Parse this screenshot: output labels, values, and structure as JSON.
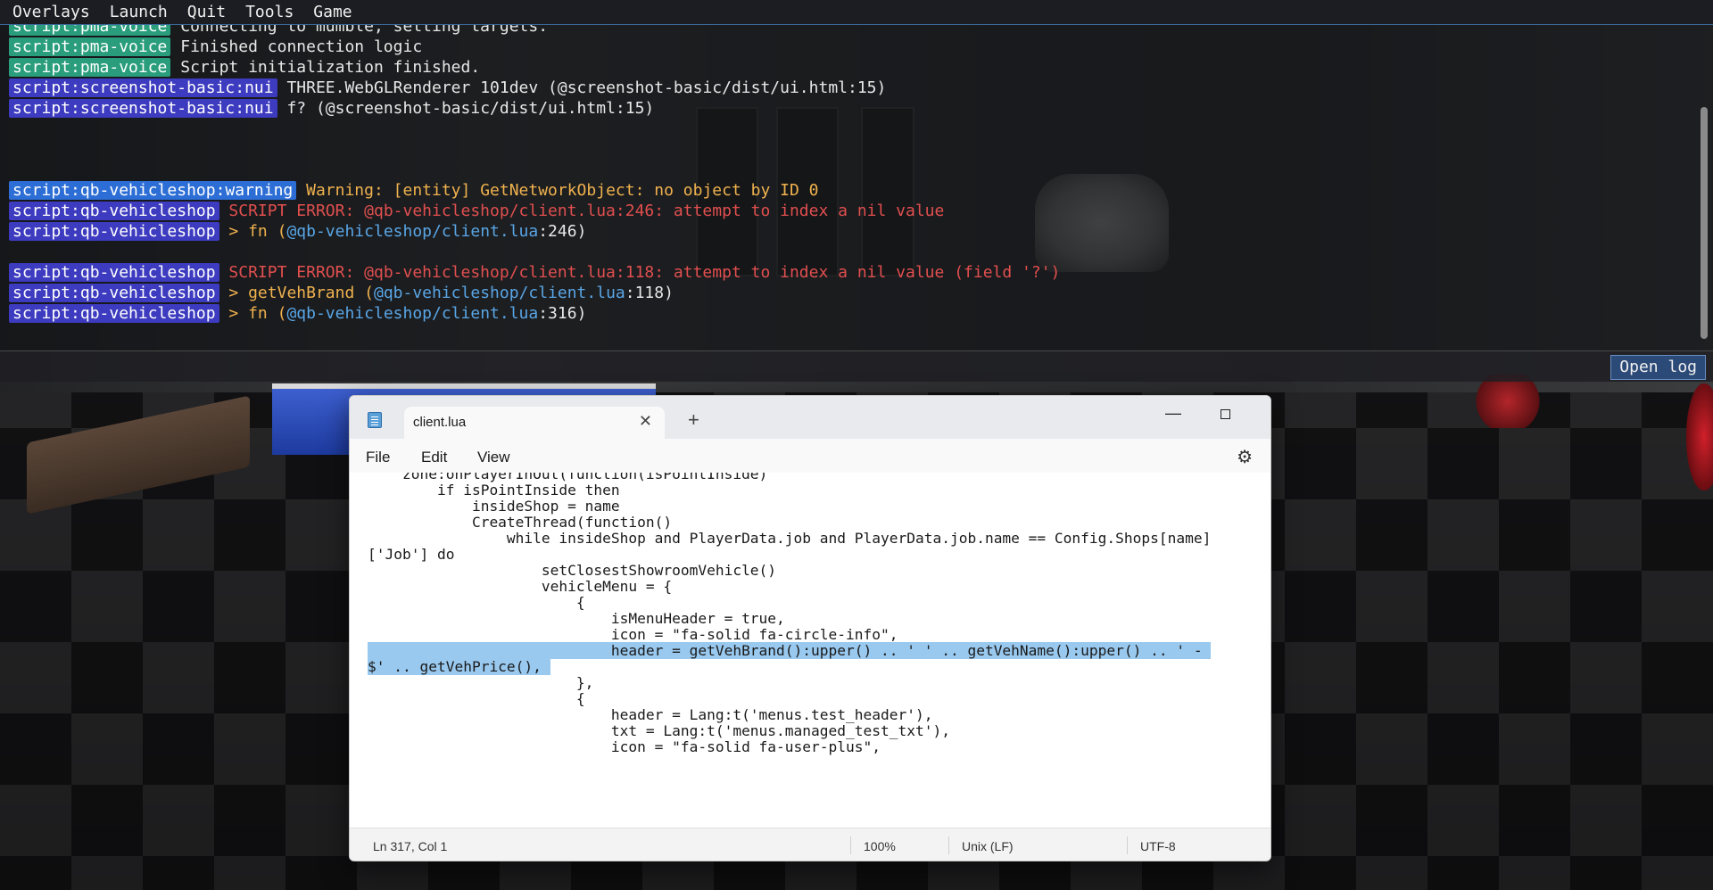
{
  "menubar": {
    "items": [
      "Overlays",
      "Launch",
      "Quit",
      "Tools",
      "Game"
    ]
  },
  "console": {
    "lines": [
      {
        "tag": "script:pma-voice",
        "tag_color": "green",
        "parts": [
          {
            "text": "Connecting to mumble, setting targets.",
            "cls": "c-white"
          }
        ]
      },
      {
        "tag": "script:pma-voice",
        "tag_color": "green",
        "parts": [
          {
            "text": "Finished connection logic",
            "cls": "c-white"
          }
        ]
      },
      {
        "tag": "script:pma-voice",
        "tag_color": "green",
        "parts": [
          {
            "text": "Script initialization finished.",
            "cls": "c-white"
          }
        ]
      },
      {
        "tag": "script:screenshot-basic:nui",
        "tag_color": "purple",
        "parts": [
          {
            "text": "THREE.WebGLRenderer 101dev (@screenshot-basic/dist/ui.html:15)",
            "cls": "c-white"
          }
        ]
      },
      {
        "tag": "script:screenshot-basic:nui",
        "tag_color": "purple",
        "parts": [
          {
            "text": "f? (@screenshot-basic/dist/ui.html:15)",
            "cls": "c-white"
          }
        ]
      },
      {
        "tag": "",
        "tag_color": "",
        "parts": []
      },
      {
        "tag": "",
        "tag_color": "",
        "parts": []
      },
      {
        "tag": "",
        "tag_color": "",
        "parts": []
      },
      {
        "tag": "script:qb-vehicleshop:warning",
        "tag_color": "blue",
        "parts": [
          {
            "text": "Warning: [entity] GetNetworkObject: no object by ID 0",
            "cls": "c-warn"
          }
        ]
      },
      {
        "tag": "script:qb-vehicleshop",
        "tag_color": "purple",
        "parts": [
          {
            "text": "SCRIPT ERROR: @qb-vehicleshop/client.lua:246: attempt to index a nil value",
            "cls": "c-err"
          }
        ]
      },
      {
        "tag": "script:qb-vehicleshop",
        "tag_color": "purple",
        "parts": [
          {
            "text": "> fn (",
            "cls": "c-orange"
          },
          {
            "text": "@qb-vehicleshop/client.lua",
            "cls": "c-link"
          },
          {
            "text": ":246)",
            "cls": "c-white"
          }
        ]
      },
      {
        "tag": "",
        "tag_color": "",
        "parts": []
      },
      {
        "tag": "script:qb-vehicleshop",
        "tag_color": "purple",
        "parts": [
          {
            "text": "SCRIPT ERROR: @qb-vehicleshop/client.lua:118: attempt to index a nil value (field '?')",
            "cls": "c-err"
          }
        ]
      },
      {
        "tag": "script:qb-vehicleshop",
        "tag_color": "purple",
        "parts": [
          {
            "text": "> getVehBrand (",
            "cls": "c-orange"
          },
          {
            "text": "@qb-vehicleshop/client.lua",
            "cls": "c-link"
          },
          {
            "text": ":118)",
            "cls": "c-white"
          }
        ]
      },
      {
        "tag": "script:qb-vehicleshop",
        "tag_color": "purple",
        "parts": [
          {
            "text": "> fn (",
            "cls": "c-orange"
          },
          {
            "text": "@qb-vehicleshop/client.lua",
            "cls": "c-link"
          },
          {
            "text": ":316)",
            "cls": "c-white"
          }
        ]
      }
    ],
    "input_value": "",
    "open_log_label": "Open log"
  },
  "notepad": {
    "tab_title": "client.lua",
    "tab_close": "✕",
    "new_tab": "+",
    "win_min": "—",
    "win_close": "✕",
    "menu": {
      "file": "File",
      "edit": "Edit",
      "view": "View"
    },
    "settings_icon": "⚙",
    "code_lines": [
      {
        "text": "    zone:onPlayerInOut(function(isPointInside)",
        "hl": false,
        "clip": true
      },
      {
        "text": "        if isPointInside then",
        "hl": false
      },
      {
        "text": "            insideShop = name",
        "hl": false
      },
      {
        "text": "            CreateThread(function()",
        "hl": false
      },
      {
        "text": "                while insideShop and PlayerData.job and PlayerData.job.name == Config.Shops[name]",
        "hl": false
      },
      {
        "text": "['Job'] do",
        "hl": false
      },
      {
        "text": "                    setClosestShowroomVehicle()",
        "hl": false
      },
      {
        "text": "                    vehicleMenu = {",
        "hl": false
      },
      {
        "text": "                        {",
        "hl": false
      },
      {
        "text": "                            isMenuHeader = true,",
        "hl": false
      },
      {
        "text": "                            icon = \"fa-solid fa-circle-info\",",
        "hl": false
      },
      {
        "text": "                            header = getVehBrand():upper() .. ' ' .. getVehName():upper() .. ' - ",
        "hl": true
      },
      {
        "text": "$' .. getVehPrice(), ",
        "hl": true
      },
      {
        "text": "                        },",
        "hl": false
      },
      {
        "text": "                        {",
        "hl": false
      },
      {
        "text": "                            header = Lang:t('menus.test_header'),",
        "hl": false
      },
      {
        "text": "                            txt = Lang:t('menus.managed_test_txt'),",
        "hl": false
      },
      {
        "text": "                            icon = \"fa-solid fa-user-plus\",",
        "hl": false
      }
    ],
    "status": {
      "position": "Ln 317, Col 1",
      "zoom": "100%",
      "line_ending": "Unix (LF)",
      "encoding": "UTF-8"
    }
  }
}
